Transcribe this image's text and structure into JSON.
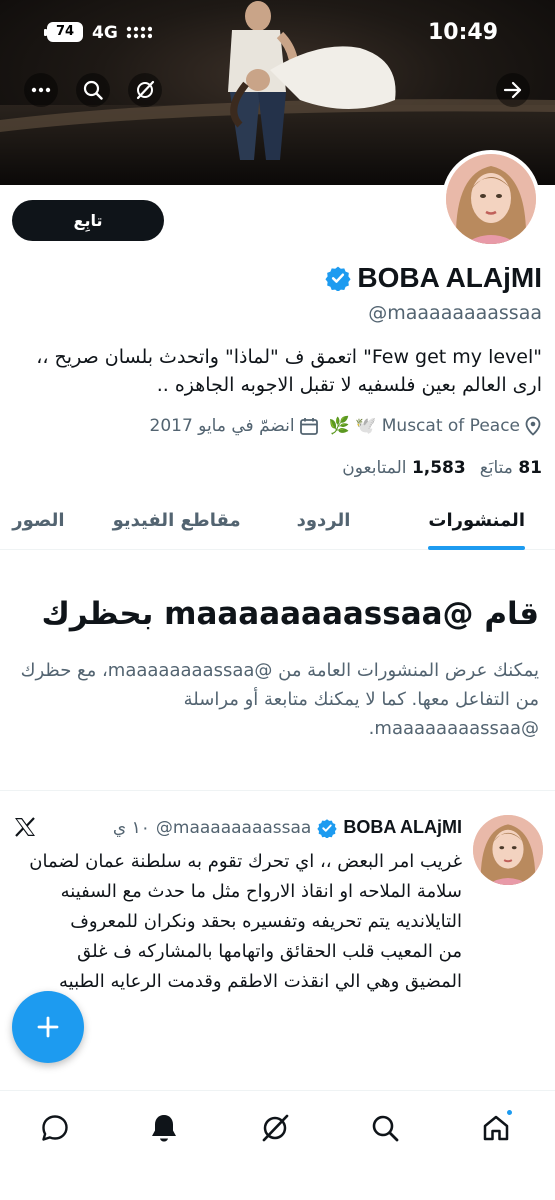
{
  "status_bar": {
    "battery": "74",
    "network": "4G",
    "time": "10:49"
  },
  "profile": {
    "display_name": "BOBA ALAjMI",
    "handle": "@maaaaaaaassaa",
    "follow_label": "تابِع",
    "bio": "\"Few get my level\" اتعمق ف \"لماذا\" واتحدث بلسان صريح ،، ارى العالم بعين فلسفيه لا تقبل الاجوبه الجاهزه ..",
    "location": "Muscat of Peace 🕊️ 🌿",
    "joined": "انضمّ في مايو 2017",
    "following_count": "81",
    "following_label": "متابَع",
    "followers_count": "1,583",
    "followers_label": "المتابعون"
  },
  "tabs": [
    {
      "label": "المنشورات",
      "active": true
    },
    {
      "label": "الردود",
      "active": false
    },
    {
      "label": "مقاطع الفيديو",
      "active": false
    },
    {
      "label": "الصور",
      "active": false
    }
  ],
  "blocked": {
    "title": "قام @maaaaaaaassaa بحظرك",
    "description": "يمكنك عرض المنشورات العامة من @maaaaaaaassaa، مع حظرك من التفاعل معها. كما لا يمكنك متابعة أو مراسلة @maaaaaaaassaa."
  },
  "post": {
    "name": "BOBA ALAjMI",
    "handle": "@maaaaaaaassaa",
    "time": "١٠ ي",
    "text": "غريب امر البعض ،،  اي تحرك تقوم به سلطنة عمان لضمان سلامة الملاحه او انقاذ الارواح مثل ما حدث مع السفينه التايلانديه يتم تحريفه وتفسيره بحقد ونكران للمعروف\n من المعيب قلب الحقائق واتهامها بالمشاركه ف غلق المضيق وهي الي انقذت الاطقم وقدمت الرعايه الطبيه"
  },
  "colors": {
    "accent": "#1d9bf0",
    "text": "#0f1419",
    "secondary": "#536471"
  },
  "icons": {
    "banner": [
      "more-icon",
      "search-icon",
      "grok-icon",
      "forward-arrow-icon"
    ],
    "nav": [
      "messages-icon",
      "notifications-icon",
      "grok-icon",
      "search-icon",
      "home-icon"
    ]
  }
}
